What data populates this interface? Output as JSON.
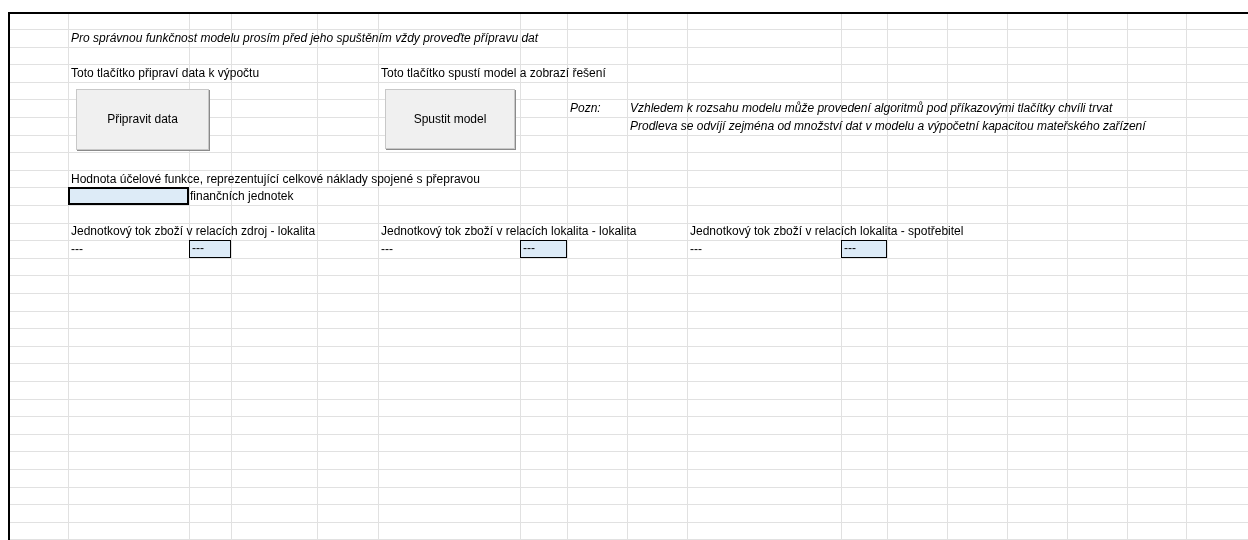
{
  "intro": "Pro správnou funkčnost modelu prosím před jeho spuštěním vždy proveďte přípravu dat",
  "prepare": {
    "label": "Toto tlačítko připraví data k výpočtu",
    "button": "Připravit data"
  },
  "run": {
    "label": "Toto tlačítko spustí model a zobrazí řešení",
    "button": "Spustit model"
  },
  "note": {
    "label": "Pozn:",
    "lines": [
      "Vzhledem k rozsahu modelu může provedení algoritmů pod příkazovými tlačítky chvíli trvat",
      "Prodleva se odvíjí zejména od množství dat v modelu a výpočetní kapacitou mateřského zařízení"
    ]
  },
  "objective": {
    "label": "Hodnota účelové funkce, reprezentující celkové náklady spojené s přepravou",
    "unit": "finančních jednotek"
  },
  "flows": [
    {
      "label": "Jednotkový tok zboží v relacích zdroj - lokalita",
      "text": "---",
      "value": "---"
    },
    {
      "label": "Jednotkový tok zboží v relacích lokalita - lokalita",
      "text": "---",
      "value": "---"
    },
    {
      "label": "Jednotkový tok zboží v relacích lokalita - spotřebitel",
      "text": "---",
      "value": "---"
    }
  ]
}
